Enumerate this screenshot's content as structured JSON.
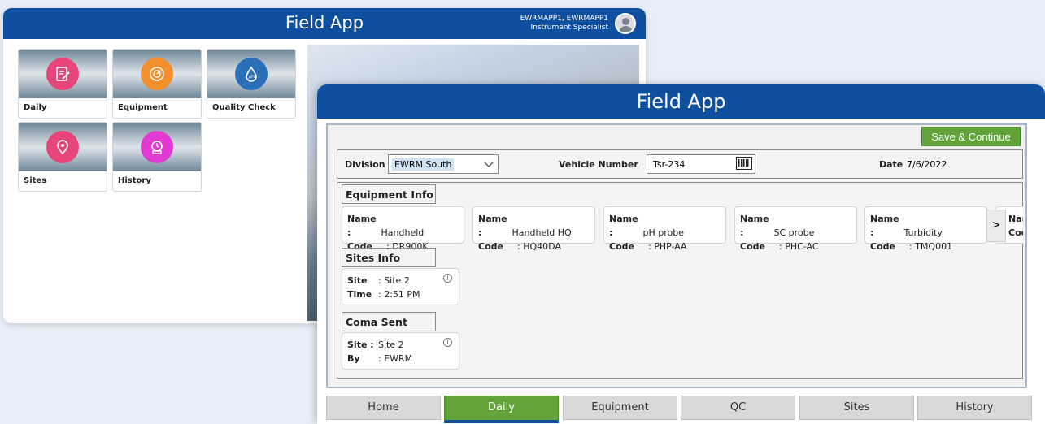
{
  "back": {
    "title": "Field App",
    "user_line1": "EWRMAPP1, EWRMAPP1",
    "user_line2": "Instrument Specialist",
    "tiles": [
      {
        "label": "Daily",
        "icon": "clipboard-edit-icon",
        "color": "#e8467a"
      },
      {
        "label": "Equipment",
        "icon": "gauge-icon",
        "color": "#f28e2b"
      },
      {
        "label": "Quality Check",
        "icon": "water-drop-icon",
        "color": "#2a6fb8"
      },
      {
        "label": "Sites",
        "icon": "location-pin-icon",
        "color": "#e8467a"
      },
      {
        "label": "History",
        "icon": "history-icon",
        "color": "#e03ad2"
      }
    ]
  },
  "front": {
    "title": "Field App",
    "save_label": "Save & Continue",
    "division_label": "Division",
    "division_value": "EWRM South",
    "vehicle_label": "Vehicle Number",
    "vehicle_value": "Tsr-234",
    "date_label": "Date",
    "date_value": "7/6/2022",
    "equipment_title": "Equipment Info",
    "name_label": "Name :",
    "code_label": "Code",
    "equipment": [
      {
        "name": "Handheld",
        "code": ": DR900K"
      },
      {
        "name": "Handheld HQ",
        "code": ": HQ40DA"
      },
      {
        "name": "pH probe",
        "code": ": PHP-AA"
      },
      {
        "name": "SC probe",
        "code": ": PHC-AC"
      },
      {
        "name": "Turbidity",
        "code": ": TMQ001"
      }
    ],
    "partial_card": {
      "line1": "Nar",
      "line2": "Coc"
    },
    "sites_title": "Sites Info",
    "site_card": {
      "k1": "Site",
      "v1": ":  Site 2",
      "k2": "Time",
      "v2": ": 2:51 PM"
    },
    "coma_title": "Coma Sent",
    "coma_card": {
      "k1": "Site :",
      "v1": "Site 2",
      "k2": "By",
      "v2": ":  EWRM"
    },
    "tabs": [
      "Home",
      "Daily",
      "Equipment",
      "QC",
      "Sites",
      "History"
    ],
    "active_tab": "Daily"
  }
}
